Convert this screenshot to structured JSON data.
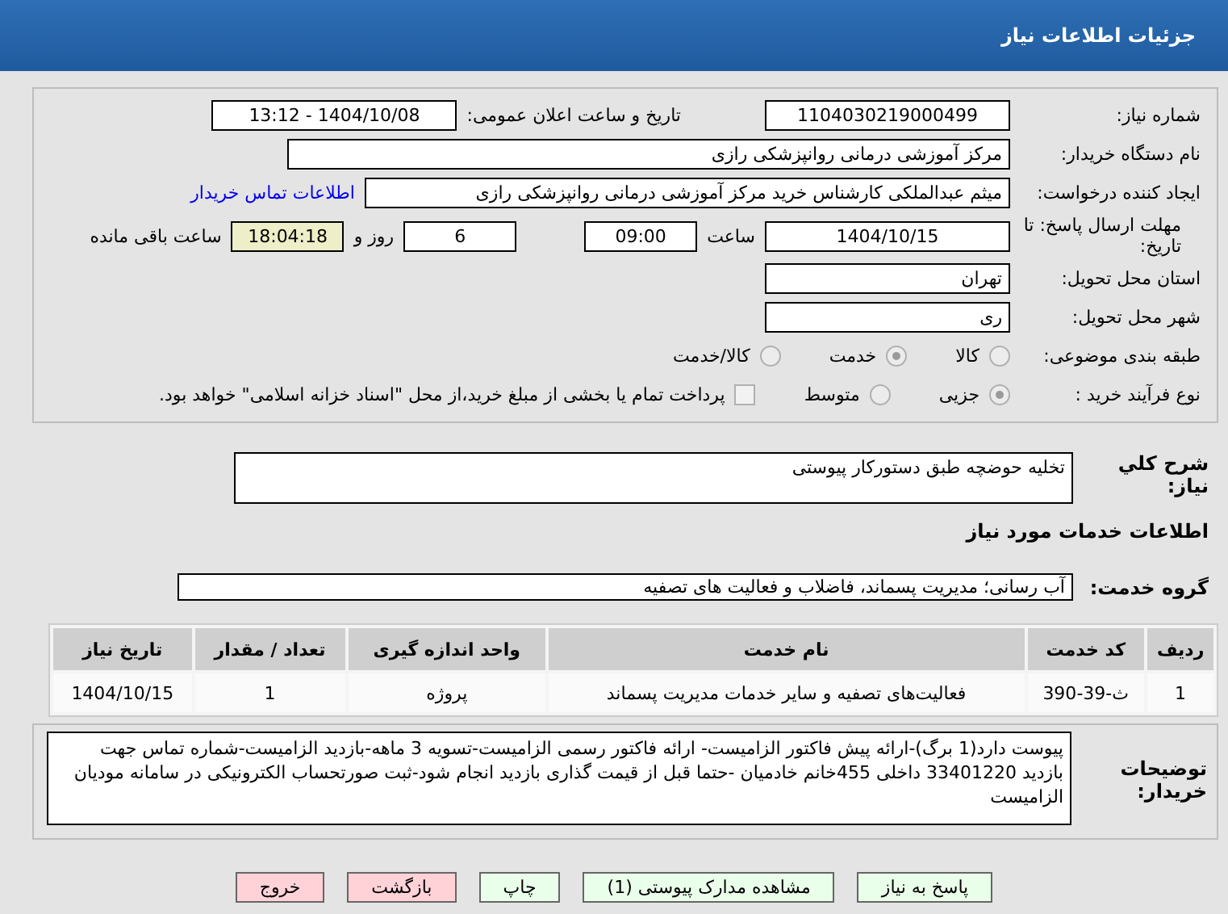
{
  "header": {
    "title": "جزئیات اطلاعات نیاز"
  },
  "need_number": {
    "label": "شماره نیاز:",
    "value": "1104030219000499"
  },
  "announce": {
    "label": "تاریخ و ساعت اعلان عمومی:",
    "value": "1404/10/08 - 13:12"
  },
  "buyer": {
    "label": "نام دستگاه خریدار:",
    "value": "مرکز آموزشی درمانی روانپزشکی رازی"
  },
  "creator": {
    "label": "ایجاد کننده درخواست:",
    "value": "میثم عبدالملکی کارشناس خرید مرکز آموزشی درمانی روانپزشکی رازی",
    "link": "اطلاعات تماس خریدار"
  },
  "deadline": {
    "label": "مهلت ارسال پاسخ: تا تاریخ:",
    "date": "1404/10/15",
    "time_label": "ساعت",
    "time": "09:00",
    "days": "6",
    "days_label": "روز و",
    "remaining": "18:04:18",
    "remaining_label": "ساعت باقی مانده"
  },
  "province": {
    "label": "استان محل تحویل:",
    "value": "تهران"
  },
  "city": {
    "label": "شهر محل تحویل:",
    "value": "ری"
  },
  "category": {
    "label": "طبقه بندی موضوعی:",
    "options": [
      {
        "label": "کالا",
        "selected": false
      },
      {
        "label": "خدمت",
        "selected": true
      },
      {
        "label": "کالا/خدمت",
        "selected": false
      }
    ]
  },
  "process": {
    "label": "نوع فرآیند خرید :",
    "options": [
      {
        "label": "جزیی",
        "selected": true
      },
      {
        "label": "متوسط",
        "selected": false
      }
    ],
    "payment": {
      "checked": false,
      "label": "پرداخت تمام یا بخشی از مبلغ خرید،از محل \"اسناد خزانه اسلامی\" خواهد بود."
    }
  },
  "description": {
    "label": "شرح کلي نياز:",
    "value": "تخلیه حوضچه طبق دستورکار پیوستی"
  },
  "services_title": "اطلاعات خدمات مورد نیاز",
  "service_group": {
    "label": "گروه خدمت:",
    "value": "آب رسانی؛ مدیریت پسماند، فاضلاب و فعالیت های تصفیه"
  },
  "table": {
    "columns": [
      "ردیف",
      "کد خدمت",
      "نام خدمت",
      "واحد اندازه گیری",
      "تعداد / مقدار",
      "تاریخ نیاز"
    ],
    "rows": [
      [
        "1",
        "ث-39-390",
        "فعالیت‌های تصفیه و سایر خدمات مدیریت پسماند",
        "پروژه",
        "1",
        "1404/10/15"
      ]
    ]
  },
  "notes": {
    "label": "توضیحات خریدار:",
    "value": "پیوست دارد(1 برگ)-ارائه پیش فاکتور الزامیست- ارائه فاکتور رسمی الزامیست-تسویه 3 ماهه-بازدید الزامیست-شماره تماس جهت بازدید 33401220 داخلی 455خانم خادمیان -حتما قبل از قیمت گذاری بازدید انجام شود-ثبت صورتحساب الکترونیکی در سامانه مودیان الزامیست"
  },
  "buttons": [
    {
      "label": "پاسخ به نیاز",
      "kind": "action"
    },
    {
      "label": "مشاهده مدارک پیوستی (1)",
      "kind": "action"
    },
    {
      "label": "چاپ",
      "kind": "action"
    },
    {
      "label": "بازگشت",
      "kind": "danger"
    },
    {
      "label": "خروج",
      "kind": "danger"
    }
  ]
}
